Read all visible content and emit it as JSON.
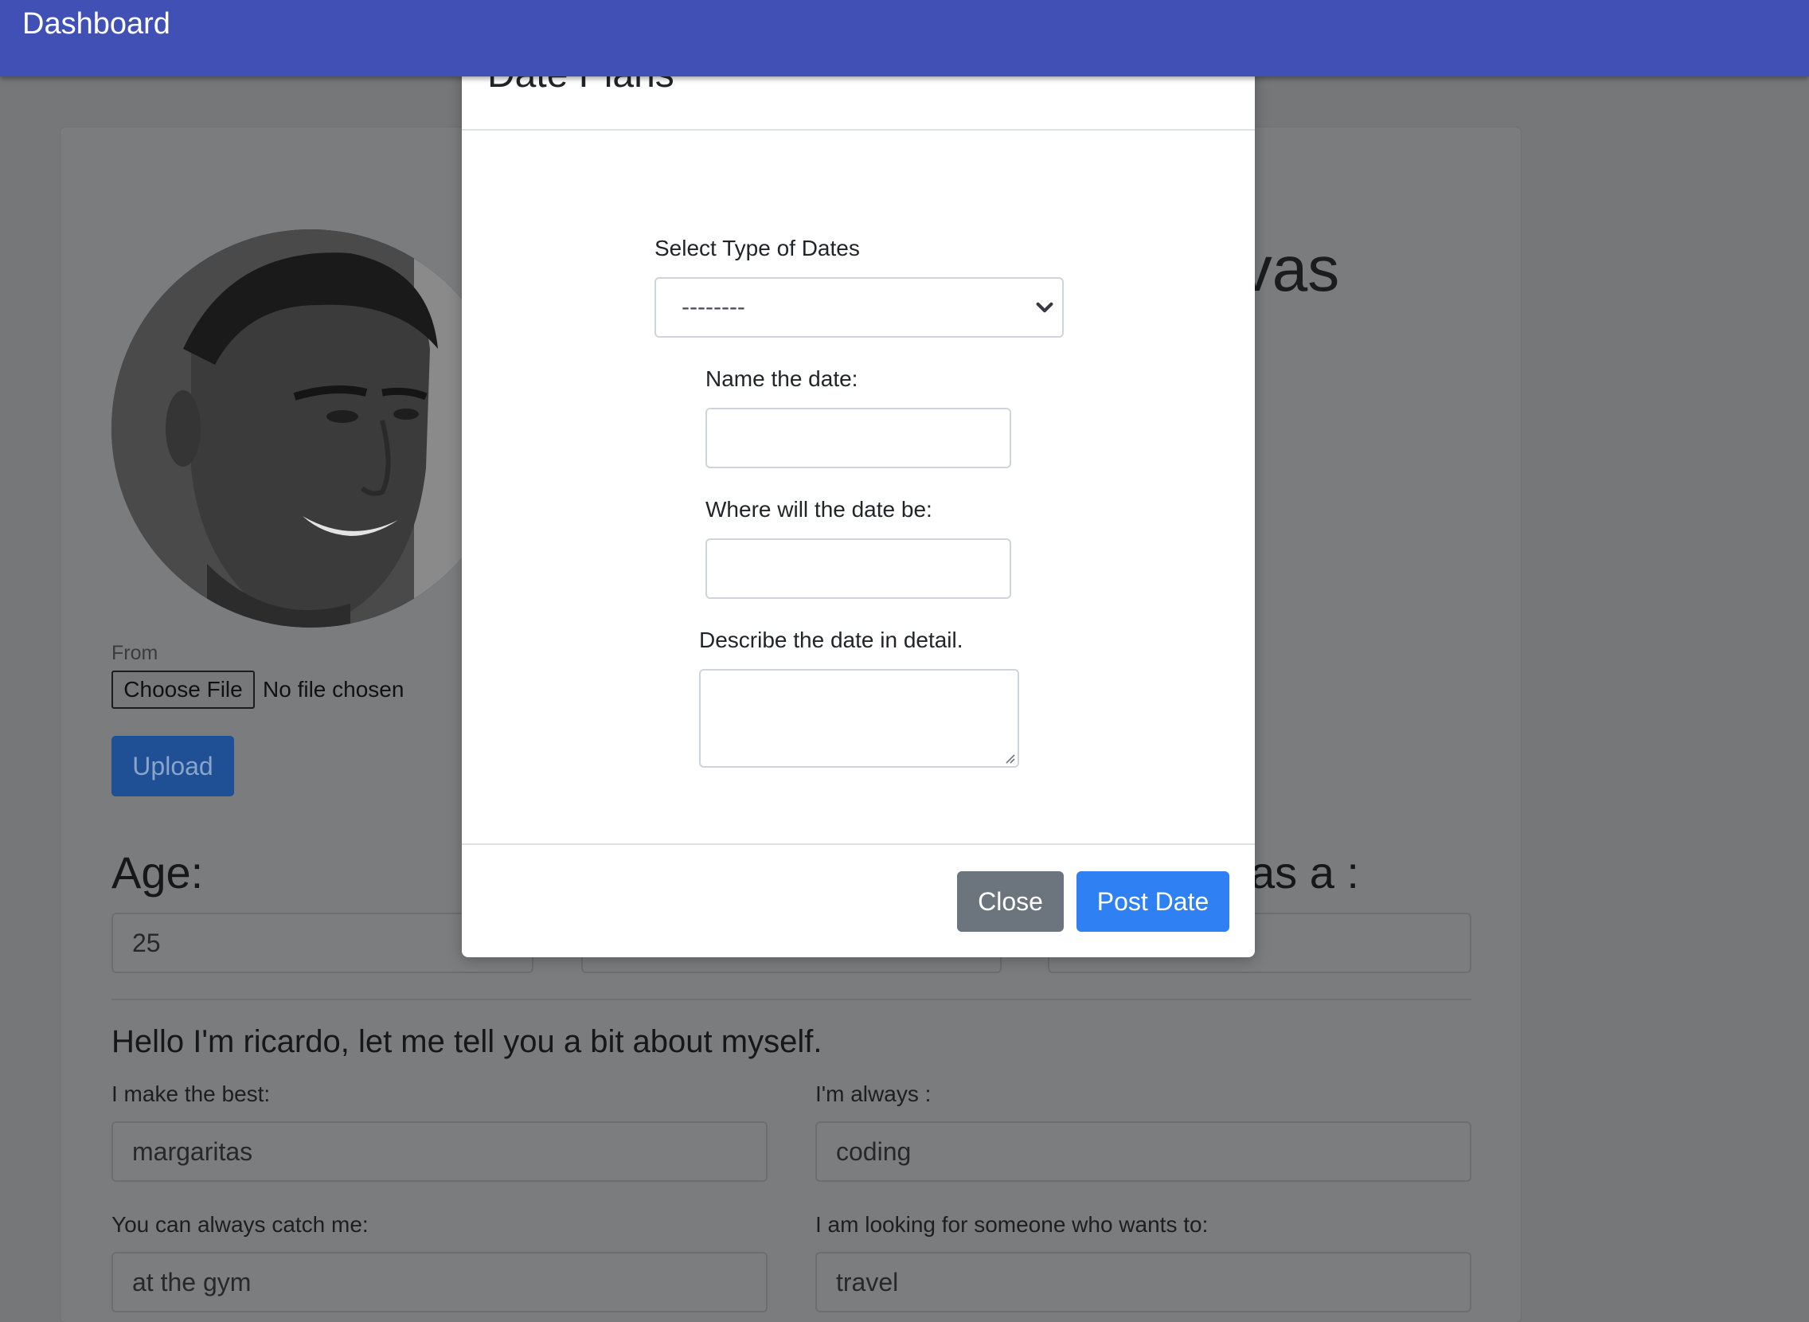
{
  "navbar": {
    "brand": "Dashboard"
  },
  "profile": {
    "name_fragment": "lvas",
    "from_label": "From",
    "choose_file_label": "Choose File",
    "file_status": "No file chosen",
    "upload_label": "Upload",
    "age_title": "Age:",
    "age_value": "25",
    "third_title_fragment": "as a :",
    "intro": "Hello I'm ricardo, let me tell you a bit about myself.",
    "fields": [
      {
        "label": "I make the best:",
        "value": "margaritas"
      },
      {
        "label": "I'm always :",
        "value": "coding"
      },
      {
        "label": "You can always catch me:",
        "value": "at the gym"
      },
      {
        "label": "I am looking for someone who wants to:",
        "value": "travel"
      }
    ]
  },
  "modal": {
    "title": "Date Plans",
    "close_glyph": "×",
    "select_label": "Select Type of Dates",
    "select_value": "--------",
    "name_label": "Name the date:",
    "name_value": "",
    "where_label": "Where will the date be:",
    "where_value": "",
    "describe_label": "Describe the date in detail.",
    "describe_value": "",
    "close_button": "Close",
    "post_button": "Post Date"
  }
}
